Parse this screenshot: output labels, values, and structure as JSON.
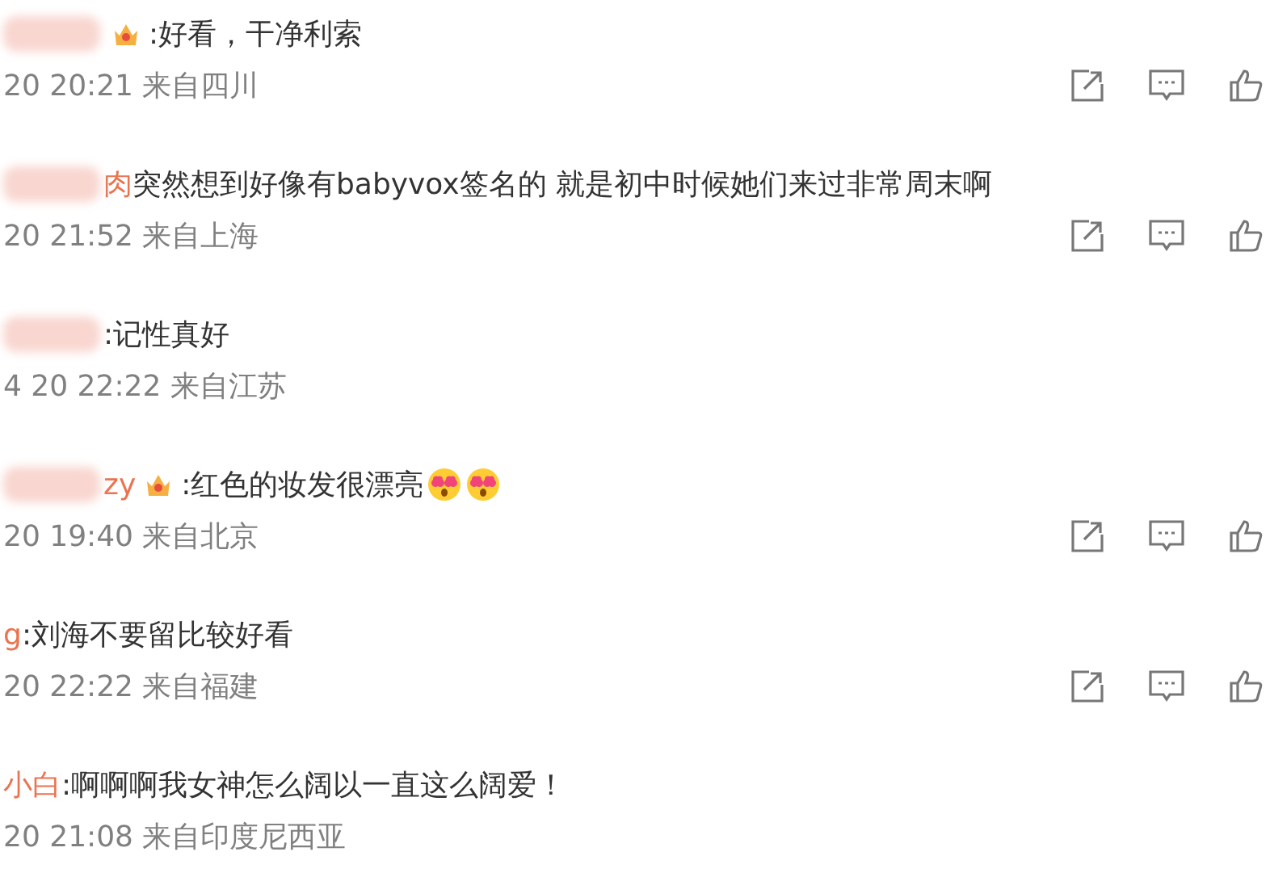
{
  "comments": [
    {
      "blurred": true,
      "badge": true,
      "text": ":好看，干净利索",
      "meta": "20 20:21 来自四川",
      "actions": true
    },
    {
      "name": "肉",
      "blurred": true,
      "badge": false,
      "text": " 突然想到好像有babyvox签名的 就是初中时候她们来过非常周末啊",
      "meta": "20 21:52 来自上海",
      "actions": true
    },
    {
      "blurred": true,
      "badge": false,
      "text": ":记性真好",
      "meta": "4 20 22:22 来自江苏",
      "actions": false
    },
    {
      "name": "zy",
      "blurred": true,
      "badge": true,
      "text": ":红色的妆发很漂亮",
      "emojis": [
        {
          "kind": "heart-eyes"
        },
        {
          "kind": "heart-eyes"
        }
      ],
      "meta": "20 19:40 来自北京",
      "actions": true
    },
    {
      "name": "g",
      "blurred": false,
      "badge": false,
      "text": ":刘海不要留比较好看",
      "meta": "20 22:22 来自福建",
      "actions": true
    },
    {
      "name": "小白",
      "blurred": false,
      "badge": false,
      "text": ":啊啊啊我女神怎么阔以一直这么阔爱！",
      "meta": "20 21:08 来自印度尼西亚",
      "actions": false
    }
  ]
}
